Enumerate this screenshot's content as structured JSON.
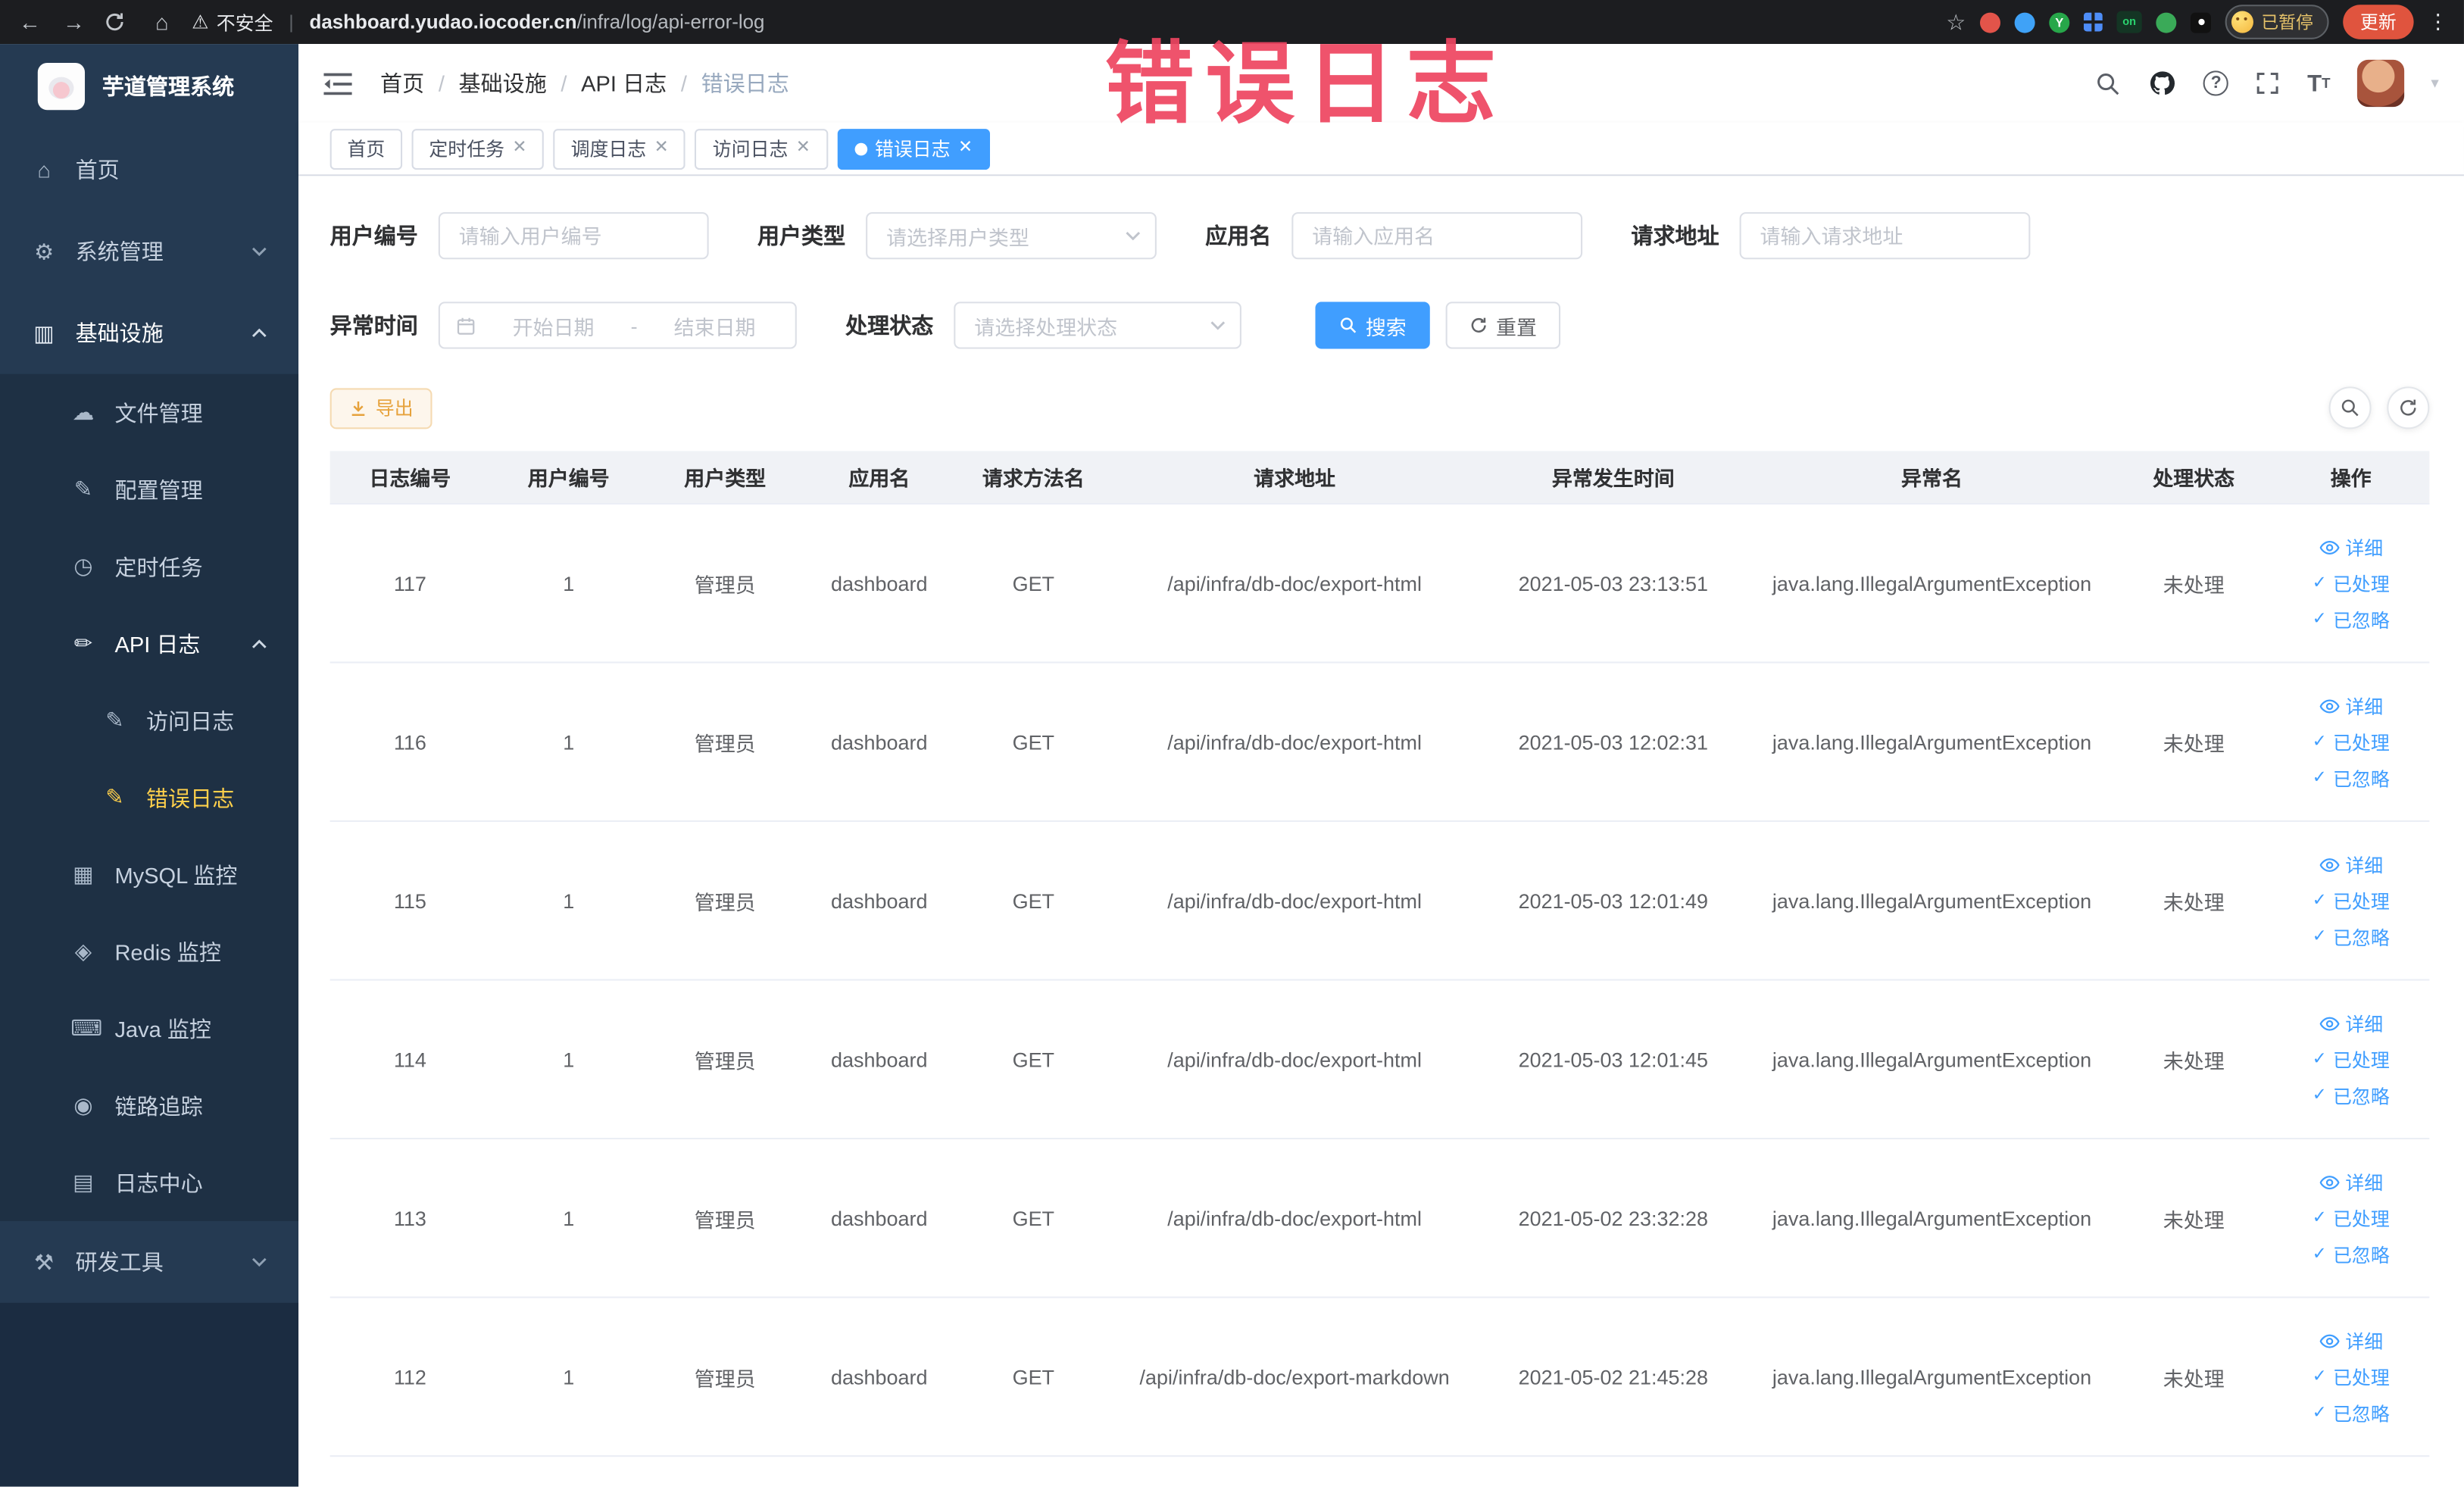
{
  "browser": {
    "security_label": "不安全",
    "url_domain": "dashboard.yudao.iocoder.cn",
    "url_path": "/infra/log/api-error-log",
    "ext_y_label": "Y",
    "ext_on_label": "on",
    "profile_paused_label": "已暂停",
    "update_label": "更新"
  },
  "watermark": "错误日志",
  "sidebar": {
    "logo_title": "芋道管理系统",
    "items": [
      {
        "label": "首页"
      },
      {
        "label": "系统管理"
      },
      {
        "label": "基础设施"
      },
      {
        "label": "文件管理"
      },
      {
        "label": "配置管理"
      },
      {
        "label": "定时任务"
      },
      {
        "label": "API 日志"
      },
      {
        "label": "访问日志"
      },
      {
        "label": "错误日志"
      },
      {
        "label": "MySQL 监控"
      },
      {
        "label": "Redis 监控"
      },
      {
        "label": "Java 监控"
      },
      {
        "label": "链路追踪"
      },
      {
        "label": "日志中心"
      },
      {
        "label": "研发工具"
      }
    ]
  },
  "breadcrumb": [
    "首页",
    "基础设施",
    "API 日志",
    "错误日志"
  ],
  "tabs": [
    {
      "label": "首页"
    },
    {
      "label": "定时任务"
    },
    {
      "label": "调度日志"
    },
    {
      "label": "访问日志"
    },
    {
      "label": "错误日志"
    }
  ],
  "filters": {
    "user_id_label": "用户编号",
    "user_id_placeholder": "请输入用户编号",
    "user_type_label": "用户类型",
    "user_type_placeholder": "请选择用户类型",
    "app_name_label": "应用名",
    "app_name_placeholder": "请输入应用名",
    "request_url_label": "请求地址",
    "request_url_placeholder": "请输入请求地址",
    "exception_time_label": "异常时间",
    "start_placeholder": "开始日期",
    "range_separator": "-",
    "end_placeholder": "结束日期",
    "process_status_label": "处理状态",
    "process_status_placeholder": "请选择处理状态",
    "search_label": "搜索",
    "reset_label": "重置"
  },
  "toolbar": {
    "export_label": "导出"
  },
  "table": {
    "columns": [
      "日志编号",
      "用户编号",
      "用户类型",
      "应用名",
      "请求方法名",
      "请求地址",
      "异常发生时间",
      "异常名",
      "处理状态",
      "操作"
    ],
    "actions": [
      "详细",
      "已处理",
      "已忽略"
    ],
    "rows": [
      {
        "log_id": "117",
        "user_id": "1",
        "user_type": "管理员",
        "app_name": "dashboard",
        "method": "GET",
        "request_url": "/api/infra/db-doc/export-html",
        "time": "2021-05-03 23:13:51",
        "exception": "java.lang.IllegalArgumentException",
        "status": "未处理"
      },
      {
        "log_id": "116",
        "user_id": "1",
        "user_type": "管理员",
        "app_name": "dashboard",
        "method": "GET",
        "request_url": "/api/infra/db-doc/export-html",
        "time": "2021-05-03 12:02:31",
        "exception": "java.lang.IllegalArgumentException",
        "status": "未处理"
      },
      {
        "log_id": "115",
        "user_id": "1",
        "user_type": "管理员",
        "app_name": "dashboard",
        "method": "GET",
        "request_url": "/api/infra/db-doc/export-html",
        "time": "2021-05-03 12:01:49",
        "exception": "java.lang.IllegalArgumentException",
        "status": "未处理"
      },
      {
        "log_id": "114",
        "user_id": "1",
        "user_type": "管理员",
        "app_name": "dashboard",
        "method": "GET",
        "request_url": "/api/infra/db-doc/export-html",
        "time": "2021-05-03 12:01:45",
        "exception": "java.lang.IllegalArgumentException",
        "status": "未处理"
      },
      {
        "log_id": "113",
        "user_id": "1",
        "user_type": "管理员",
        "app_name": "dashboard",
        "method": "GET",
        "request_url": "/api/infra/db-doc/export-html",
        "time": "2021-05-02 23:32:28",
        "exception": "java.lang.IllegalArgumentException",
        "status": "未处理"
      },
      {
        "log_id": "112",
        "user_id": "1",
        "user_type": "管理员",
        "app_name": "dashboard",
        "method": "GET",
        "request_url": "/api/infra/db-doc/export-markdown",
        "time": "2021-05-02 21:45:28",
        "exception": "java.lang.IllegalArgumentException",
        "status": "未处理"
      }
    ]
  }
}
